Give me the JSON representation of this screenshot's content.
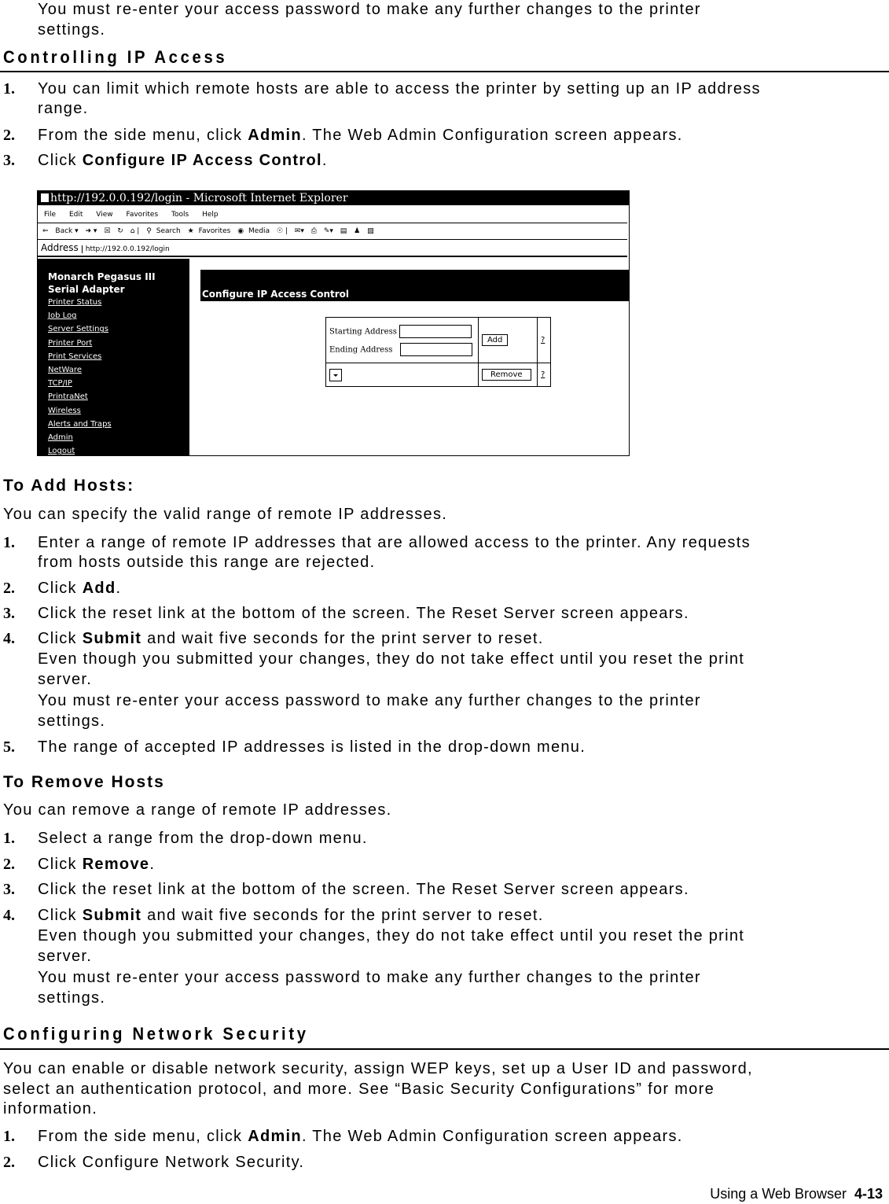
{
  "intro": {
    "line1": "You must re-enter your access password to make any further changes to the printer",
    "line2": "settings."
  },
  "section1": {
    "heading": "Controlling IP Access",
    "steps": [
      {
        "num": "1.",
        "lines": [
          "You can limit which remote hosts are able to access the printer by setting up an IP address",
          "range."
        ]
      },
      {
        "num": "2.",
        "pre": "From the side menu, click ",
        "bold": "Admin",
        "post": ".  The Web Admin Configuration screen appears."
      },
      {
        "num": "3.",
        "pre": "Click ",
        "bold": "Configure IP Access Control",
        "post": "."
      }
    ]
  },
  "screenshot": {
    "window_title": "http://192.0.0.192/login - Microsoft Internet Explorer",
    "menu": [
      "File",
      "Edit",
      "View",
      "Favorites",
      "Tools",
      "Help"
    ],
    "toolbar": [
      "Back",
      "Search",
      "Favorites",
      "Media"
    ],
    "address_label": "Address",
    "address_url": "http://192.0.0.192/login",
    "sidebar_title_1": "Monarch Pegasus III",
    "sidebar_title_2": "Serial Adapter",
    "sidebar_links": [
      "Printer Status",
      "Job Log",
      "Server Settings",
      "Printer Port",
      "Print Services",
      "NetWare",
      "TCP/IP",
      "PrintraNet",
      "Wireless",
      "Alerts and Traps",
      "Admin",
      "Logout"
    ],
    "content_title": "Configure IP Access Control",
    "starting_label": "Starting Address",
    "ending_label": "Ending Address",
    "add_button": "Add",
    "remove_button": "Remove",
    "help": "?"
  },
  "add_hosts": {
    "heading": "To Add Hosts:",
    "intro": "You can specify the valid range of remote IP addresses.",
    "step1_a": "Enter a range of remote IP addresses that are allowed access to the printer.  Any requests",
    "step1_b": "from hosts outside this range are rejected.",
    "step2_pre": "Click ",
    "step2_bold": "Add",
    "step2_post": ".",
    "step3": "Click the reset link at the bottom of the screen.  The Reset Server screen appears.",
    "step4_pre": "Click ",
    "step4_bold": "Submit",
    "step4_post": " and wait five seconds for the print server to reset.",
    "step4_l2": "Even though you submitted your changes, they do not take effect until you reset the print",
    "step4_l3": "server.",
    "step4_l4": "You must re-enter your access password to make any further changes to the printer",
    "step4_l5": "settings.",
    "step5": "The range of accepted IP addresses is listed in the drop-down menu."
  },
  "remove_hosts": {
    "heading": "To Remove Hosts",
    "intro": "You can remove a range of remote IP addresses.",
    "step1": "Select a range from the drop-down menu.",
    "step2_pre": "Click ",
    "step2_bold": "Remove",
    "step2_post": ".",
    "step3": "Click the reset link at the bottom of the screen.  The Reset Server screen appears.",
    "step4_pre": "Click ",
    "step4_bold": "Submit",
    "step4_post": " and wait five seconds for the print server to reset.",
    "step4_l2": "Even though you submitted your changes, they do not take effect until you reset the print",
    "step4_l3": "server.",
    "step4_l4": "You must re-enter your access password to make any further changes to the printer",
    "step4_l5": "settings."
  },
  "section2": {
    "heading": "Configuring Network Security",
    "intro_1": "You can enable or disable network security, assign WEP keys, set up a User ID and password,",
    "intro_2": "select an authentication protocol, and more.  See “Basic Security Configurations” for more",
    "intro_3": "information.",
    "step1_pre": "From the side menu, click ",
    "step1_bold": "Admin",
    "step1_post": ". The Web Admin Configuration screen appears.",
    "step2": "Click Configure Network Security."
  },
  "footer": {
    "text": "Using a Web Browser  ",
    "page": "4-13"
  },
  "nums": [
    "1.",
    "2.",
    "3.",
    "4.",
    "5."
  ]
}
